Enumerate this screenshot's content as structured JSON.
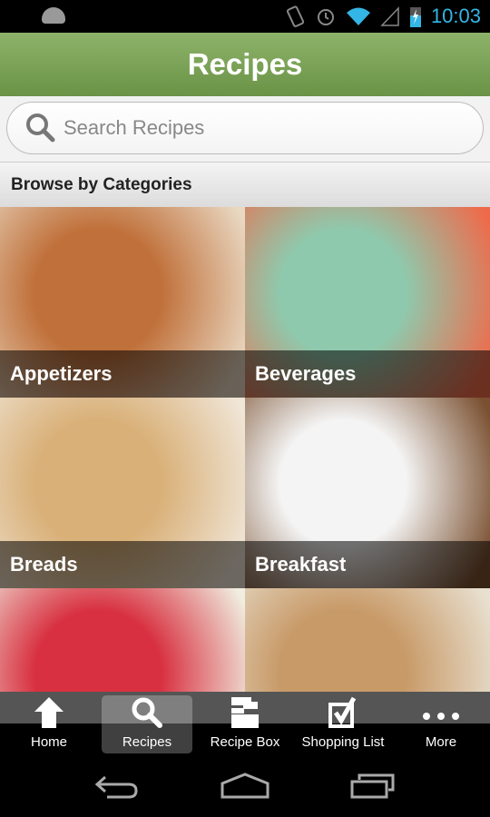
{
  "status": {
    "time": "10:03",
    "icons": [
      "android-icon",
      "vibrate-icon",
      "alarm-icon",
      "wifi-icon",
      "signal-icon",
      "battery-charging-icon"
    ],
    "accent": "#33b5e5"
  },
  "header": {
    "title": "Recipes",
    "color": "#7aa356"
  },
  "search": {
    "placeholder": "Search Recipes"
  },
  "section": {
    "title": "Browse by Categories"
  },
  "categories": [
    {
      "label": "Appetizers",
      "colors": [
        "#c0703a",
        "#e9d8c2"
      ]
    },
    {
      "label": "Beverages",
      "colors": [
        "#8fc9ad",
        "#ef6a4a"
      ]
    },
    {
      "label": "Breads",
      "colors": [
        "#d9b078",
        "#f0e6d8"
      ]
    },
    {
      "label": "Breakfast",
      "colors": [
        "#f4f4f4",
        "#7a5030"
      ]
    },
    {
      "label": "",
      "colors": [
        "#d83040",
        "#f0eee0"
      ]
    },
    {
      "label": "",
      "colors": [
        "#c89a68",
        "#e8e0d0"
      ]
    }
  ],
  "tabs": [
    {
      "label": "Home",
      "icon": "home-icon"
    },
    {
      "label": "Recipes",
      "icon": "search-icon",
      "active": true
    },
    {
      "label": "Recipe Box",
      "icon": "recipe-box-icon"
    },
    {
      "label": "Shopping List",
      "icon": "checkbox-icon"
    },
    {
      "label": "More",
      "icon": "more-icon"
    }
  ]
}
